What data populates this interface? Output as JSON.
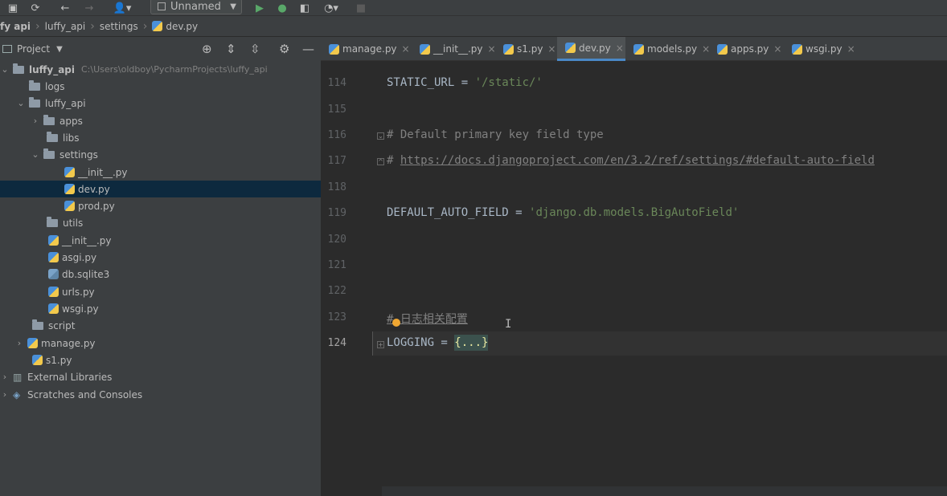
{
  "toolbar": {
    "run_config_label": "Unnamed",
    "icons": [
      "save-icon",
      "sync-icon",
      "back-icon",
      "forward-icon",
      "user-icon",
      "run-icon",
      "debug-icon",
      "coverage-icon",
      "profile-icon",
      "stop-icon"
    ]
  },
  "breadcrumb": [
    "fy api",
    "luffy_api",
    "settings",
    "dev.py"
  ],
  "project_panel": {
    "title": "Project"
  },
  "tabs": [
    {
      "label": "manage.py"
    },
    {
      "label": "__init__.py"
    },
    {
      "label": "s1.py"
    },
    {
      "label": "dev.py",
      "active": true
    },
    {
      "label": "models.py"
    },
    {
      "label": "apps.py"
    },
    {
      "label": "wsgi.py"
    }
  ],
  "tree": [
    {
      "label": "luffy_api",
      "path": "C:\\Users\\oldboy\\PycharmProjects\\luffy_api",
      "type": "folder",
      "expanded": true
    },
    {
      "label": "logs",
      "type": "folder"
    },
    {
      "label": "luffy_api",
      "type": "folder",
      "expanded": true
    },
    {
      "label": "apps",
      "type": "folder",
      "collapsed": true
    },
    {
      "label": "libs",
      "type": "folder"
    },
    {
      "label": "settings",
      "type": "folder",
      "expanded": true
    },
    {
      "label": "__init__.py",
      "type": "py"
    },
    {
      "label": "dev.py",
      "type": "py",
      "selected": true
    },
    {
      "label": "prod.py",
      "type": "py"
    },
    {
      "label": "utils",
      "type": "folder"
    },
    {
      "label": "__init__.py",
      "type": "py"
    },
    {
      "label": "asgi.py",
      "type": "py"
    },
    {
      "label": "db.sqlite3",
      "type": "db"
    },
    {
      "label": "urls.py",
      "type": "py"
    },
    {
      "label": "wsgi.py",
      "type": "py"
    },
    {
      "label": "script",
      "type": "folder"
    },
    {
      "label": "manage.py",
      "type": "py"
    },
    {
      "label": "s1.py",
      "type": "py"
    },
    {
      "label": "External Libraries",
      "type": "lib"
    },
    {
      "label": "Scratches and Consoles",
      "type": "scratch"
    }
  ],
  "editor": {
    "line_numbers": [
      "114",
      "115",
      "116",
      "117",
      "118",
      "119",
      "120",
      "121",
      "122",
      "123",
      "124"
    ],
    "code": {
      "l114_a": "STATIC_URL = ",
      "l114_b": "'/static/'",
      "l116": "# Default primary key field type",
      "l117_a": "# ",
      "l117_b": "https://docs.djangoproject.com/en/3.2/ref/settings/#default-auto-field",
      "l119_a": "DEFAULT_AUTO_FIELD = ",
      "l119_b": "'django.db.models.BigAutoField'",
      "l123": "# 日志相关配置",
      "l124_a": "LOGGING = ",
      "l124_b": "{...}"
    }
  }
}
